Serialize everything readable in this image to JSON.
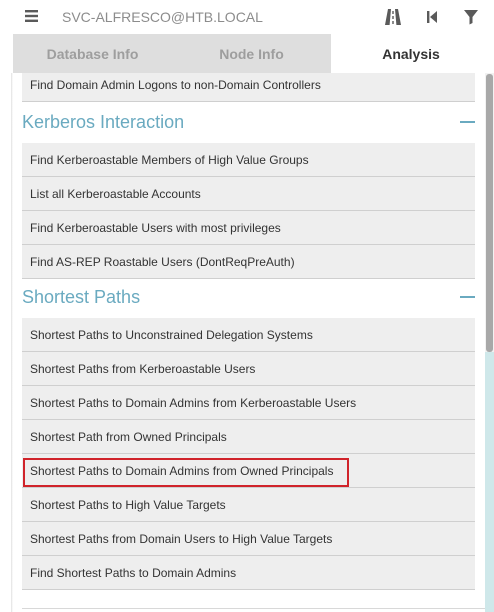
{
  "search": {
    "value": "SVC-ALFRESCO@HTB.LOCAL"
  },
  "toolbar": {
    "icons": [
      "menu-icon",
      "pathfinding-icon",
      "back-icon",
      "filter-icon"
    ]
  },
  "tabs": [
    {
      "label": "Database Info",
      "active": false
    },
    {
      "label": "Node Info",
      "active": false
    },
    {
      "label": "Analysis",
      "active": true
    }
  ],
  "top_query": {
    "label": "Find Domain Admin Logons to non-Domain Controllers"
  },
  "sections": [
    {
      "title": "Kerberos Interaction",
      "queries": [
        "Find Kerberoastable Members of High Value Groups",
        "List all Kerberoastable Accounts",
        "Find Kerberoastable Users with most privileges",
        "Find AS-REP Roastable Users (DontReqPreAuth)"
      ]
    },
    {
      "title": "Shortest Paths",
      "queries": [
        "Shortest Paths to Unconstrained Delegation Systems",
        "Shortest Paths from Kerberoastable Users",
        "Shortest Paths to Domain Admins from Kerberoastable Users",
        "Shortest Path from Owned Principals",
        "Shortest Paths to Domain Admins from Owned Principals",
        "Shortest Paths to High Value Targets",
        "Shortest Paths from Domain Users to High Value Targets",
        "Find Shortest Paths to Domain Admins"
      ]
    }
  ],
  "colors": {
    "accent": "#6aaac0",
    "highlight": "#d0232a",
    "query_bg": "#eeeeee",
    "tab_bg": "#dedede"
  }
}
